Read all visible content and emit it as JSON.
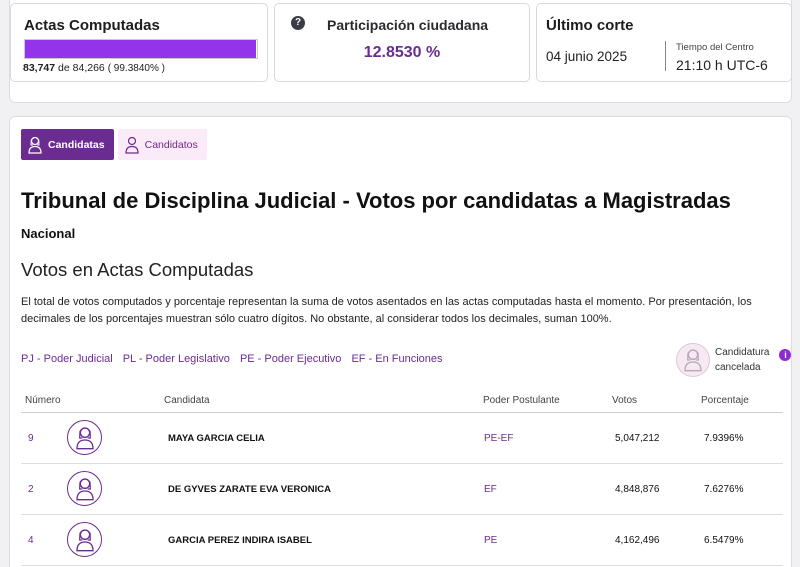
{
  "summary": {
    "actas": {
      "title": "Actas Computadas",
      "computed": "83,747",
      "of_label": "de",
      "total": "84,266",
      "percent": "( 99.3840% )",
      "progress_fraction": 0.99384
    },
    "participation": {
      "title": "Participación ciudadana",
      "value": "12.8530 %"
    },
    "last_cut": {
      "title": "Último corte",
      "date": "04 junio 2025",
      "tz_label": "Tiempo del Centro",
      "time": "21:10 h UTC-6"
    }
  },
  "tabs": [
    {
      "label": "Candidatas",
      "active": true
    },
    {
      "label": "Candidatos",
      "active": false
    }
  ],
  "heading": "Tribunal de Disciplina Judicial - Votos por candidatas a Magistradas",
  "scope": "Nacional",
  "subheading": "Votos en Actas Computadas",
  "description": "El total de votos computados y porcentaje representan la suma de votos asentados en las actas computadas hasta el momento. Por presentación, los decimales de los porcentajes muestran sólo cuatro dígitos. No obstante, al considerar todos los decimales, suman 100%.",
  "legend": [
    "PJ - Poder Judicial",
    "PL - Poder Legislativo",
    "PE - Poder Ejecutivo",
    "EF - En Funciones"
  ],
  "cancelled": {
    "line1": "Candidatura",
    "line2": "cancelada"
  },
  "table": {
    "headers": {
      "number": "Número",
      "candidate": "Candidata",
      "power": "Poder Postulante",
      "votes": "Votos",
      "percent": "Porcentaje"
    },
    "rows": [
      {
        "number": "9",
        "name": "MAYA GARCIA CELIA",
        "power": "PE-EF",
        "votes": "5,047,212",
        "percent": "7.9396%"
      },
      {
        "number": "2",
        "name": "DE GYVES ZARATE EVA VERONICA",
        "power": "EF",
        "votes": "4,848,876",
        "percent": "7.6276%"
      },
      {
        "number": "4",
        "name": "GARCIA PEREZ INDIRA ISABEL",
        "power": "PE",
        "votes": "4,162,496",
        "percent": "6.5479%"
      }
    ]
  },
  "colors": {
    "accent": "#6b2c91",
    "progress": "#9333ea",
    "tab_inactive_bg": "#fbeaf7"
  },
  "icons": {
    "help": "question-circle-icon",
    "info": "info-circle-icon",
    "avatar": "woman-avatar-icon"
  }
}
